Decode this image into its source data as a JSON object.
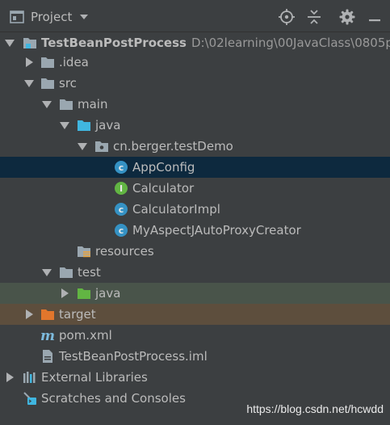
{
  "header": {
    "title": "Project"
  },
  "tree": {
    "root_name": "TestBeanPostProcess",
    "root_path": "D:\\02learning\\00JavaClass\\0805phas",
    "idea": ".idea",
    "src": "src",
    "main": "main",
    "java": "java",
    "package": "cn.berger.testDemo",
    "app_config": "AppConfig",
    "calculator": "Calculator",
    "calculator_impl": "CalculatorImpl",
    "creator": "MyAspectJAutoProxyCreator",
    "resources": "resources",
    "test": "test",
    "test_java": "java",
    "target": "target",
    "pom": "pom.xml",
    "iml": "TestBeanPostProcess.iml",
    "ext_libs": "External Libraries",
    "scratches": "Scratches and Consoles"
  },
  "watermark": "https://blog.csdn.net/hcwdd"
}
